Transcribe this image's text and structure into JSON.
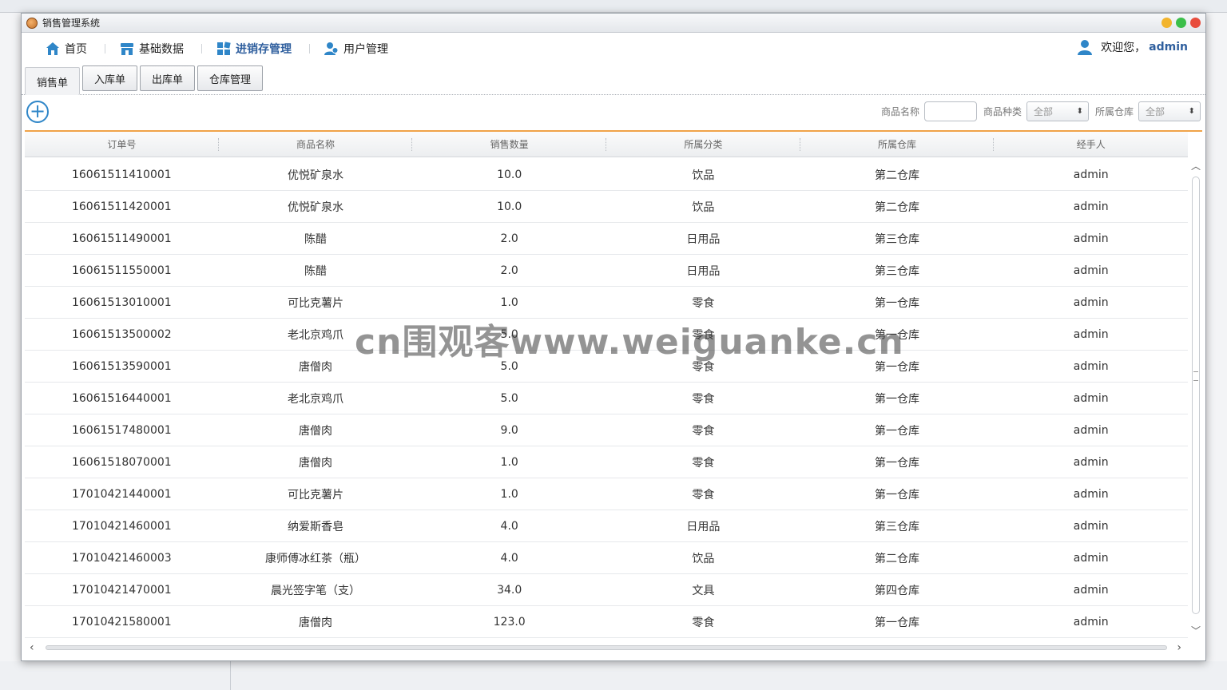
{
  "window": {
    "title": "销售管理系统"
  },
  "menu": {
    "items": [
      {
        "label": "首页",
        "icon": "home-icon"
      },
      {
        "label": "基础数据",
        "icon": "store-icon"
      },
      {
        "label": "进销存管理",
        "icon": "grid-icon"
      },
      {
        "label": "用户管理",
        "icon": "users-icon"
      }
    ],
    "active_index": 2,
    "welcome_text": "欢迎您，",
    "username": "admin"
  },
  "tabs": [
    {
      "label": "销售单"
    },
    {
      "label": "入库单"
    },
    {
      "label": "出库单"
    },
    {
      "label": "仓库管理"
    }
  ],
  "filters": {
    "product_name_label": "商品名称",
    "product_name_value": "",
    "category_label": "商品种类",
    "category_value": "全部",
    "warehouse_label": "所属仓库",
    "warehouse_value": "全部"
  },
  "table": {
    "columns": [
      "订单号",
      "商品名称",
      "销售数量",
      "所属分类",
      "所属仓库",
      "经手人"
    ],
    "rows": [
      [
        "16061511410001",
        "优悦矿泉水",
        "10.0",
        "饮品",
        "第二仓库",
        "admin"
      ],
      [
        "16061511420001",
        "优悦矿泉水",
        "10.0",
        "饮品",
        "第二仓库",
        "admin"
      ],
      [
        "16061511490001",
        "陈醋",
        "2.0",
        "日用品",
        "第三仓库",
        "admin"
      ],
      [
        "16061511550001",
        "陈醋",
        "2.0",
        "日用品",
        "第三仓库",
        "admin"
      ],
      [
        "16061513010001",
        "可比克薯片",
        "1.0",
        "零食",
        "第一仓库",
        "admin"
      ],
      [
        "16061513500002",
        "老北京鸡爪",
        "5.0",
        "零食",
        "第一仓库",
        "admin"
      ],
      [
        "16061513590001",
        "唐僧肉",
        "5.0",
        "零食",
        "第一仓库",
        "admin"
      ],
      [
        "16061516440001",
        "老北京鸡爪",
        "5.0",
        "零食",
        "第一仓库",
        "admin"
      ],
      [
        "16061517480001",
        "唐僧肉",
        "9.0",
        "零食",
        "第一仓库",
        "admin"
      ],
      [
        "16061518070001",
        "唐僧肉",
        "1.0",
        "零食",
        "第一仓库",
        "admin"
      ],
      [
        "17010421440001",
        "可比克薯片",
        "1.0",
        "零食",
        "第一仓库",
        "admin"
      ],
      [
        "17010421460001",
        "纳爱斯香皂",
        "4.0",
        "日用品",
        "第三仓库",
        "admin"
      ],
      [
        "17010421460003",
        "康师傅冰红茶（瓶）",
        "4.0",
        "饮品",
        "第二仓库",
        "admin"
      ],
      [
        "17010421470001",
        "晨光签字笔（支）",
        "34.0",
        "文具",
        "第四仓库",
        "admin"
      ],
      [
        "17010421580001",
        "唐僧肉",
        "123.0",
        "零食",
        "第一仓库",
        "admin"
      ]
    ]
  },
  "watermark": "cn围观客www.weiguanke.cn",
  "colors": {
    "accent": "#2f5f9e",
    "add_button": "#2f86c8",
    "table_top_border": "#f0a348",
    "win_close": "#e84d3d",
    "win_min": "#f2b42d",
    "win_max": "#3cbf4a"
  }
}
